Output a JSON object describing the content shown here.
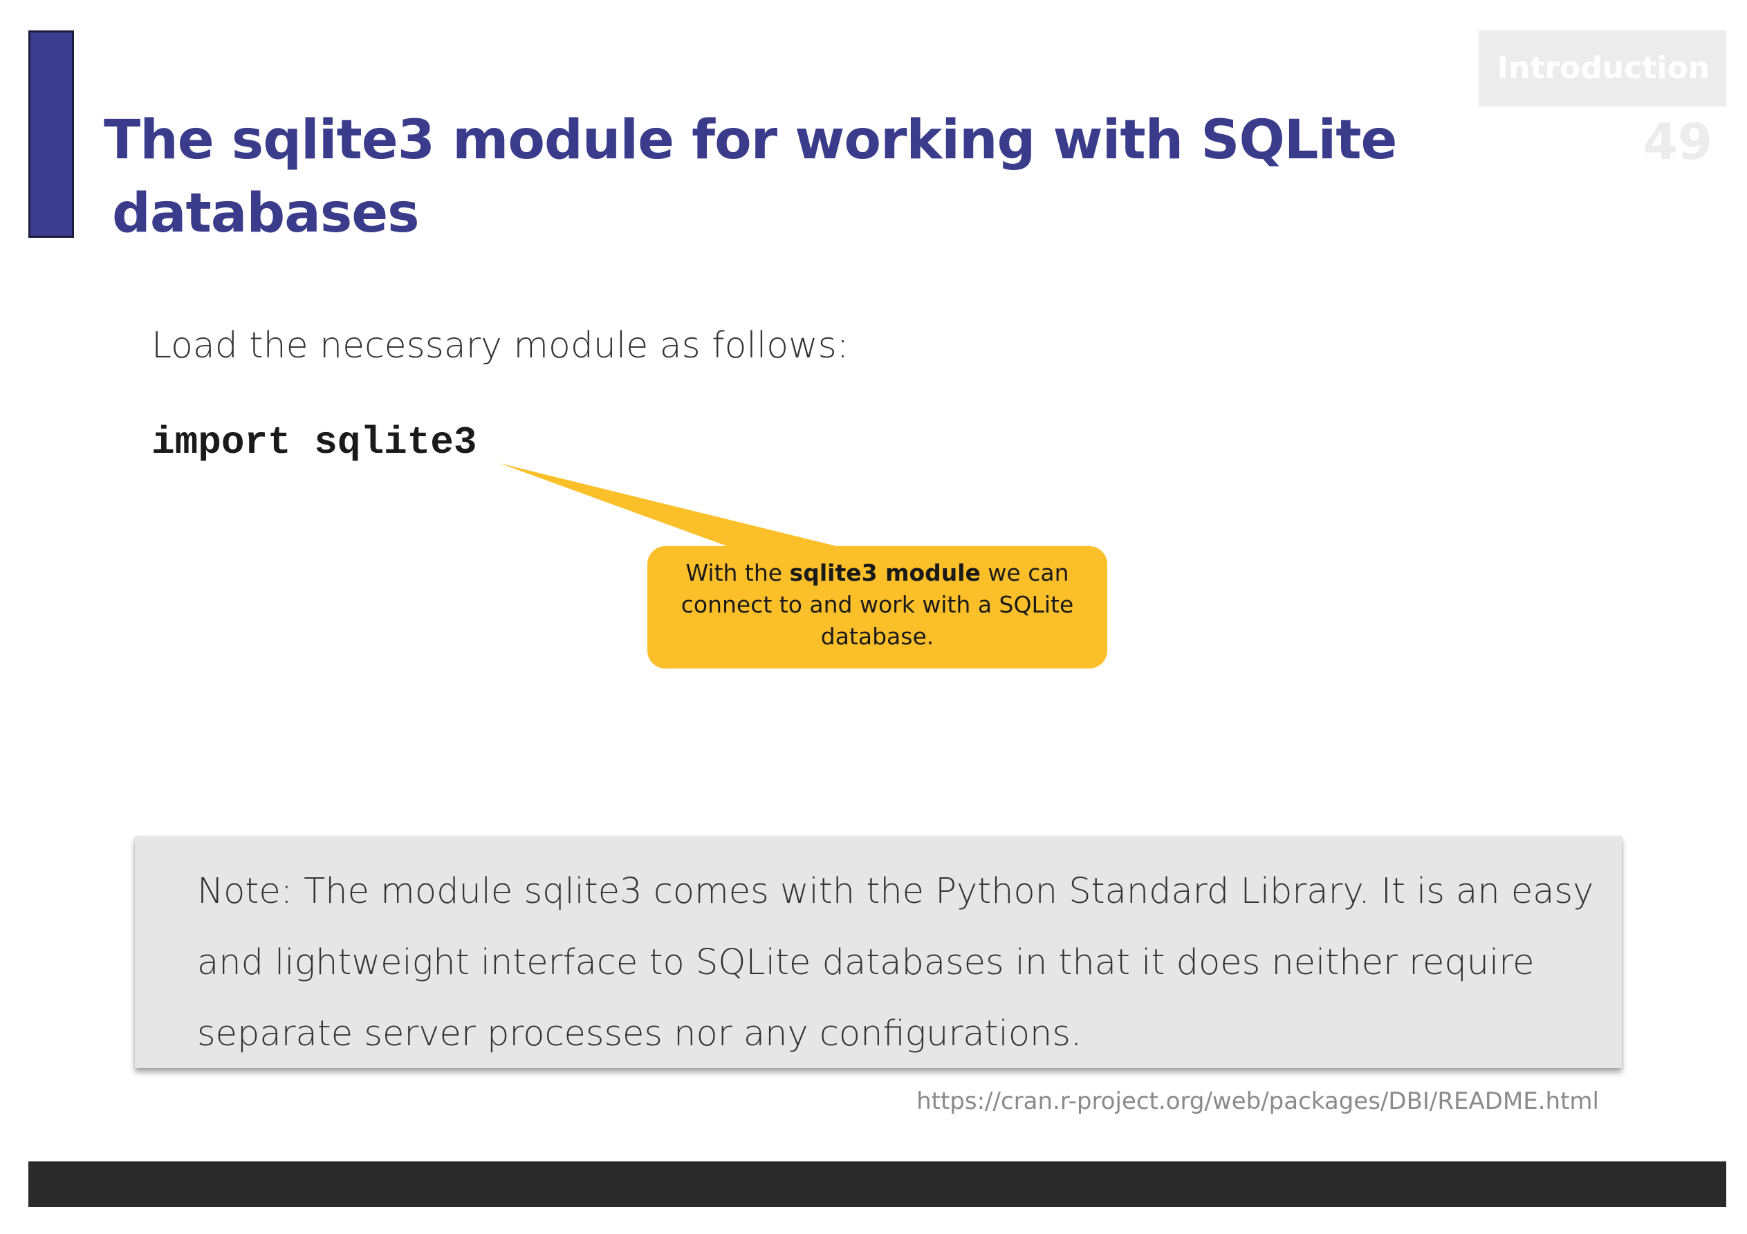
{
  "slide": {
    "title_line1": "The sqlite3 module for working with SQLite",
    "title_line2": "databases",
    "section_label": "Introduction",
    "page_number": "49"
  },
  "content": {
    "intro_text": "Load the necessary module as follows:",
    "code": "import sqlite3"
  },
  "callout": {
    "text_before": "With the ",
    "text_bold": "sqlite3 module",
    "text_after": " we can connect to and work with a SQLite database.",
    "color": "#fbbf2a"
  },
  "note": {
    "text": "Note: The module sqlite3 comes with the Python Standard Library. It is an easy and lightweight interface to SQLite databases in that it does neither require separate server processes nor any configurations."
  },
  "source": {
    "url": "https://cran.r-project.org/web/packages/DBI/README.html"
  },
  "colors": {
    "accent": "#3a3c8b",
    "footer": "#2a2a2a",
    "note_background": "#e6e6e6"
  }
}
